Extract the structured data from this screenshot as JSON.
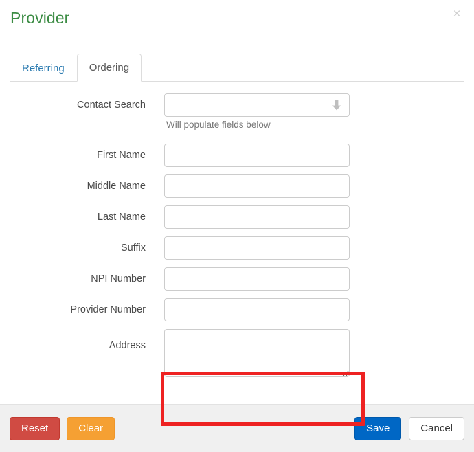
{
  "dialog": {
    "title": "Provider",
    "close_label": "×",
    "close_icon": "close-icon"
  },
  "tabs": [
    {
      "label": "Referring",
      "active": false
    },
    {
      "label": "Ordering",
      "active": true
    }
  ],
  "form": {
    "fields": [
      {
        "label": "Contact Search",
        "type": "select",
        "value": "",
        "placeholder": "",
        "help": "Will populate fields below",
        "icon": "chevron-down-icon"
      },
      {
        "label": "First Name",
        "type": "text",
        "value": "",
        "placeholder": ""
      },
      {
        "label": "Middle Name",
        "type": "text",
        "value": "",
        "placeholder": ""
      },
      {
        "label": "Last Name",
        "type": "text",
        "value": "",
        "placeholder": ""
      },
      {
        "label": "Suffix",
        "type": "text",
        "value": "",
        "placeholder": ""
      },
      {
        "label": "NPI Number",
        "type": "text",
        "value": "",
        "placeholder": ""
      },
      {
        "label": "Provider Number",
        "type": "text",
        "value": "",
        "placeholder": ""
      },
      {
        "label": "Address",
        "type": "textarea",
        "value": "",
        "placeholder": "",
        "highlighted": true
      }
    ]
  },
  "footer": {
    "reset_label": "Reset",
    "clear_label": "Clear",
    "save_label": "Save",
    "cancel_label": "Cancel"
  },
  "colors": {
    "title_green": "#3c8c44",
    "link_blue": "#2a7ab0",
    "primary_blue": "#0067c5",
    "danger_red": "#d04b43",
    "warning_orange": "#f5a033",
    "annotation_red": "#ee2222",
    "footer_bg": "#f0f0f0",
    "border_gray": "#cccccc"
  }
}
